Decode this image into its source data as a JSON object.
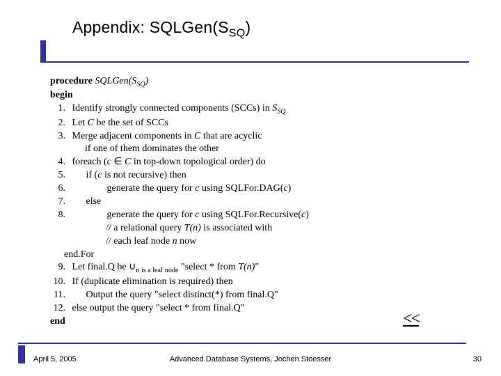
{
  "title": {
    "prefix": "Appendix: SQLGen(S",
    "sub": "SQ",
    "suffix": ")"
  },
  "proc": {
    "procedure_label": "procedure",
    "call_prefix": "SQLGen(S",
    "call_sub": "SQ",
    "call_suffix": ")",
    "begin": "begin",
    "end": "end",
    "lines": {
      "l1_pre": "Identify strongly connected components (SCCs) in ",
      "l1_sym_pre": "S",
      "l1_sym_sub": "SQ",
      "l2_pre": "Let ",
      "l2_C": "C",
      "l2_post": " be the set of SCCs",
      "l3_pre": "Merge adjacent components in ",
      "l3_C": "C",
      "l3_post": " that are acyclic",
      "l3b": "if one of them dominates the other",
      "l4_pre": "foreach (",
      "l4_c": "c",
      "l4_in": " ∈ ",
      "l4_C": "C",
      "l4_post": " in top-down topological order) do",
      "l5_pre": "if (",
      "l5_c": "c",
      "l5_post": " is not recursive) then",
      "l6_pre": "generate the query for ",
      "l6_c": "c",
      "l6_mid": " using SQLFor.DAG(",
      "l6_c2": "c",
      "l6_post": ")",
      "l7": "else",
      "l8_pre": "generate the query for ",
      "l8_c": "c",
      "l8_mid": " using SQLFor.Recursive(",
      "l8_c2": "c",
      "l8_post": ")",
      "l8b_pre": "// a relational query ",
      "l8b_T": "T(n)",
      "l8b_post": " is associated with",
      "l8c_pre": "// each leaf node ",
      "l8c_n": "n",
      "l8c_post": " now",
      "endfor": "end.For",
      "l9_pre": "Let final.Q be ∪",
      "l9_sub": "n is a leaf node",
      "l9_post": " \"select * from ",
      "l9_T": "T(n)",
      "l9_tail": "\"",
      "l10": "If (duplicate elimination is required) then",
      "l11": "Output the query \"select distinct(*) from final.Q\"",
      "l12": "else output the query \"select * from final.Q\""
    },
    "nums": {
      "n1": "1.",
      "n2": "2.",
      "n3": "3.",
      "n4": "4.",
      "n5": "5.",
      "n6": "6.",
      "n7": "7.",
      "n8": "8.",
      "n9": "9.",
      "n10": "10.",
      "n11": "11.",
      "n12": "12."
    }
  },
  "backlink": "<<",
  "footer": {
    "date": "April 5, 2005",
    "center": "Advanced Database Systems, Jochen Stoesser",
    "page": "30"
  }
}
